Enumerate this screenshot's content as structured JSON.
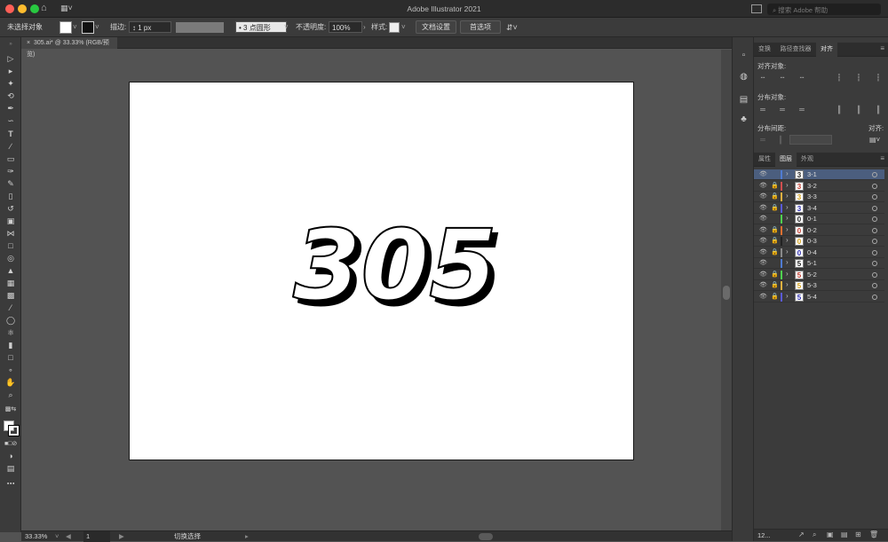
{
  "window": {
    "title": "Adobe Illustrator 2021",
    "search_placeholder": "搜索 Adobe 帮助"
  },
  "control_bar": {
    "selection_label": "未选择对象",
    "stroke_label": "描边:",
    "stroke_value": "1 px",
    "brush_value": "3 点圆形",
    "opacity_label": "不透明度:",
    "opacity_value": "100%",
    "style_label": "样式:",
    "doc_setup_button": "文档设置",
    "prefs_button": "首选项"
  },
  "document": {
    "tab_label": "305.ai* @ 33.33% (RGB/预览)",
    "artwork_text": "305"
  },
  "status_bar": {
    "zoom": "33.33%",
    "page": "1",
    "status_text": "切换选择"
  },
  "align_panel": {
    "tabs": [
      "变换",
      "路径查找器",
      "对齐"
    ],
    "active_tab": "对齐",
    "align_objects_label": "对齐对象:",
    "distribute_objects_label": "分布对象:",
    "distribute_spacing_label": "分布间距:",
    "align_to_label": "对齐:"
  },
  "layers_panel": {
    "tabs": [
      "属性",
      "图层",
      "外观"
    ],
    "active_tab": "图层",
    "layers": [
      {
        "name": "3-1",
        "color": "#4f7bd1",
        "glyph": "3",
        "glyph_color": "#222",
        "selected": true,
        "locked": false
      },
      {
        "name": "3-2",
        "color": "#d14f4f",
        "glyph": "3",
        "glyph_color": "#c0392b",
        "selected": false,
        "locked": true
      },
      {
        "name": "3-3",
        "color": "#e0b040",
        "glyph": "3",
        "glyph_color": "#d4a017",
        "selected": false,
        "locked": true
      },
      {
        "name": "3-4",
        "color": "#5a5ad8",
        "glyph": "3",
        "glyph_color": "#2a2ab0",
        "selected": false,
        "locked": true
      },
      {
        "name": "0-1",
        "color": "#4fd14f",
        "glyph": "0",
        "glyph_color": "#222",
        "selected": false,
        "locked": false
      },
      {
        "name": "0-2",
        "color": "#e07030",
        "glyph": "0",
        "glyph_color": "#c0392b",
        "selected": false,
        "locked": true
      },
      {
        "name": "0-3",
        "color": "#222222",
        "glyph": "0",
        "glyph_color": "#d4a017",
        "selected": false,
        "locked": true
      },
      {
        "name": "0-4",
        "color": "#8a8a8a",
        "glyph": "0",
        "glyph_color": "#2a2ab0",
        "selected": false,
        "locked": true
      },
      {
        "name": "5-1",
        "color": "#4f7bd1",
        "glyph": "5",
        "glyph_color": "#222",
        "selected": false,
        "locked": false
      },
      {
        "name": "5-2",
        "color": "#4fd14f",
        "glyph": "5",
        "glyph_color": "#c0392b",
        "selected": false,
        "locked": true
      },
      {
        "name": "5-3",
        "color": "#e0b040",
        "glyph": "5",
        "glyph_color": "#d4a017",
        "selected": false,
        "locked": true
      },
      {
        "name": "5-4",
        "color": "#5a5ad8",
        "glyph": "5",
        "glyph_color": "#2a2ab0",
        "selected": false,
        "locked": true
      }
    ],
    "footer_count": "12..."
  }
}
